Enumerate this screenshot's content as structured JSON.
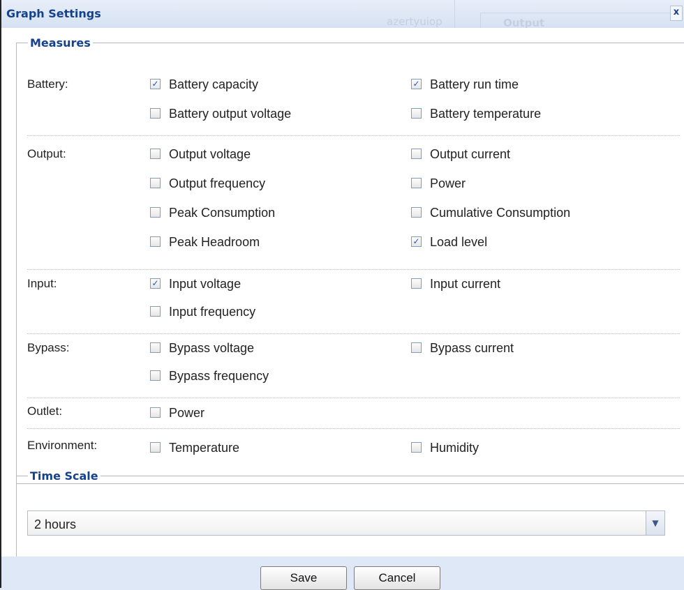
{
  "window": {
    "title": "Graph Settings",
    "close_glyph": "x",
    "bg_text_1": "azertyuiop",
    "bg_text_2": "Output"
  },
  "measures": {
    "legend": "Measures",
    "rows": [
      {
        "label": "Battery:",
        "options": [
          {
            "label": "Battery capacity",
            "checked": true
          },
          {
            "label": "Battery run time",
            "checked": true
          },
          {
            "label": "Battery output voltage",
            "checked": false
          },
          {
            "label": "Battery temperature",
            "checked": false
          }
        ]
      },
      {
        "label": "Output:",
        "options": [
          {
            "label": "Output voltage",
            "checked": false
          },
          {
            "label": "Output current",
            "checked": false
          },
          {
            "label": "Output frequency",
            "checked": false
          },
          {
            "label": "Power",
            "checked": false
          },
          {
            "label": "Peak Consumption",
            "checked": false
          },
          {
            "label": "Cumulative Consumption",
            "checked": false
          },
          {
            "label": "Peak Headroom",
            "checked": false
          },
          {
            "label": "Load level",
            "checked": true
          }
        ]
      },
      {
        "label": "Input:",
        "options": [
          {
            "label": "Input voltage",
            "checked": true
          },
          {
            "label": "Input current",
            "checked": false
          },
          {
            "label": "Input frequency",
            "checked": false
          }
        ]
      },
      {
        "label": "Bypass:",
        "options": [
          {
            "label": "Bypass voltage",
            "checked": false
          },
          {
            "label": "Bypass current",
            "checked": false
          },
          {
            "label": "Bypass frequency",
            "checked": false
          }
        ]
      },
      {
        "label": "Outlet:",
        "options": [
          {
            "label": "Power",
            "checked": false
          }
        ]
      },
      {
        "label": "Environment:",
        "options": [
          {
            "label": "Temperature",
            "checked": false
          },
          {
            "label": "Humidity",
            "checked": false
          }
        ]
      }
    ]
  },
  "time_scale": {
    "legend": "Time Scale",
    "selected": "2 hours"
  },
  "buttons": {
    "save": "Save",
    "cancel": "Cancel"
  },
  "colors": {
    "accent": "#15428b",
    "check": "#1f55c2"
  }
}
